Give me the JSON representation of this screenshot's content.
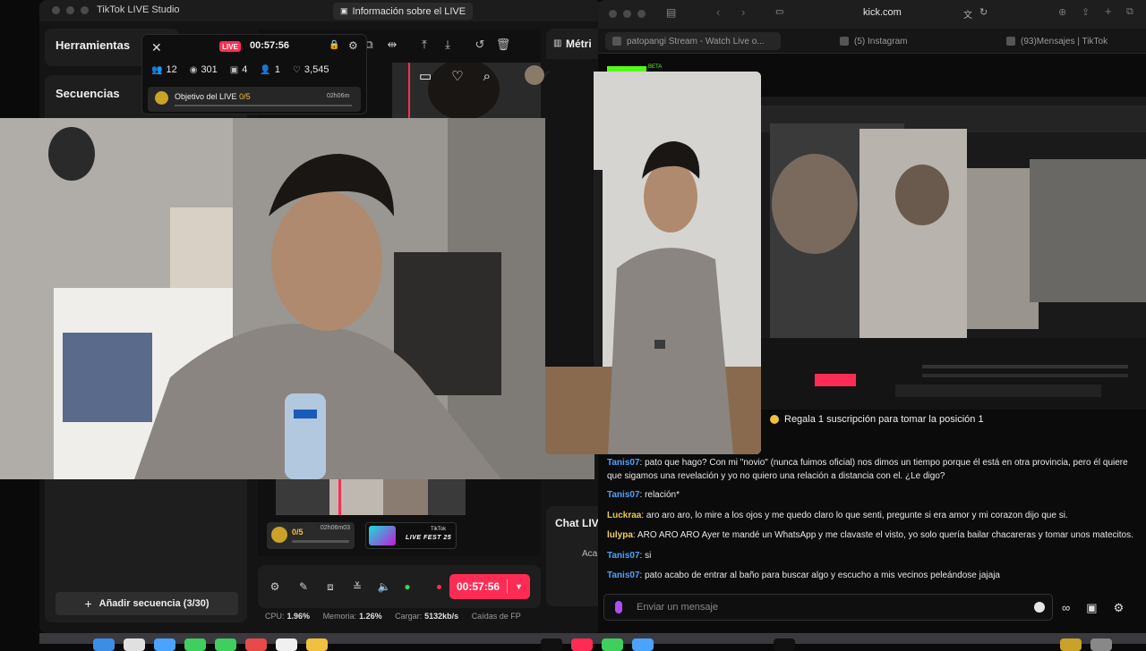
{
  "studio": {
    "window_title": "TikTok LIVE Studio",
    "info_button": "Información sobre el LIVE",
    "tools_title": "Herramientas",
    "sequences_title": "Secuencias",
    "add_sequence": "Añadir secuencia (3/30)",
    "metrics_tab": "Métri",
    "chat_live_title": "Chat LIV",
    "chat_live_preview": "Aca",
    "timer": "00:57:56",
    "goal_mini": {
      "count": "0/5",
      "time": "02h06m03"
    },
    "live_fest": {
      "brand": "TikTok",
      "title": "LIVE FEST 25"
    },
    "stats": {
      "cpu_label": "CPU:",
      "cpu_value": "1.96%",
      "memory_label": "Memoria:",
      "memory_value": "1.26%",
      "upload_label": "Cargar:",
      "upload_value": "5132kb/s",
      "drops_label": "Caídas de FP"
    }
  },
  "live_popup": {
    "badge": "LIVE",
    "timer": "00:57:56",
    "viewers": "12",
    "views": "301",
    "gifts": "4",
    "follows": "1",
    "likes": "3,545",
    "goal_label": "Objetivo del LIVE",
    "goal_count": "0/5",
    "goal_time": "02h06m"
  },
  "safari": {
    "url": "kick.com",
    "tabs": [
      {
        "label": "patopangi Stream - Watch Live o..."
      },
      {
        "label": "(5) Instagram"
      },
      {
        "label": "(93)Mensajes | TikTok"
      }
    ]
  },
  "kick": {
    "logo_badge": "BETA",
    "sub_banner": "Regala 1 suscripción para tomar la posición 1",
    "chat_placeholder": "Enviar un mensaje",
    "messages": [
      {
        "user": "Tanis07",
        "color": "#4aa3ff",
        "text": "pato que hago? Con mi \"novio\" (nunca fuimos oficial) nos dimos un tiempo porque él está en otra provincia, pero él quiere que sigamos una revelación y yo no quiero una relación a distancia con el. ¿Le digo?"
      },
      {
        "user": "Tanis07",
        "color": "#4aa3ff",
        "text": "relación*"
      },
      {
        "user": "Luckraa",
        "color": "#e8c94a",
        "text": "aro aro aro, lo mire a los ojos y me quedo claro lo que senti, pregunte si era amor y mi corazon dijo que si."
      },
      {
        "user": "lulypa",
        "color": "#f0d060",
        "text": "ARO ARO ARO Ayer te mandé un WhatsApp y me clavaste el visto, yo solo quería bailar chacareras y tomar unos matecitos."
      },
      {
        "user": "Tanis07",
        "color": "#4aa3ff",
        "text": "si"
      },
      {
        "user": "Tanis07",
        "color": "#4aa3ff",
        "text": "pato acabo de entrar al baño para buscar algo y escucho a mis vecinos peleándose jajaja"
      }
    ]
  },
  "colors": {
    "tiktok_accent": "#fe2c55",
    "kick_green": "#53fc18",
    "chat_user_blue": "#4aa3ff"
  }
}
